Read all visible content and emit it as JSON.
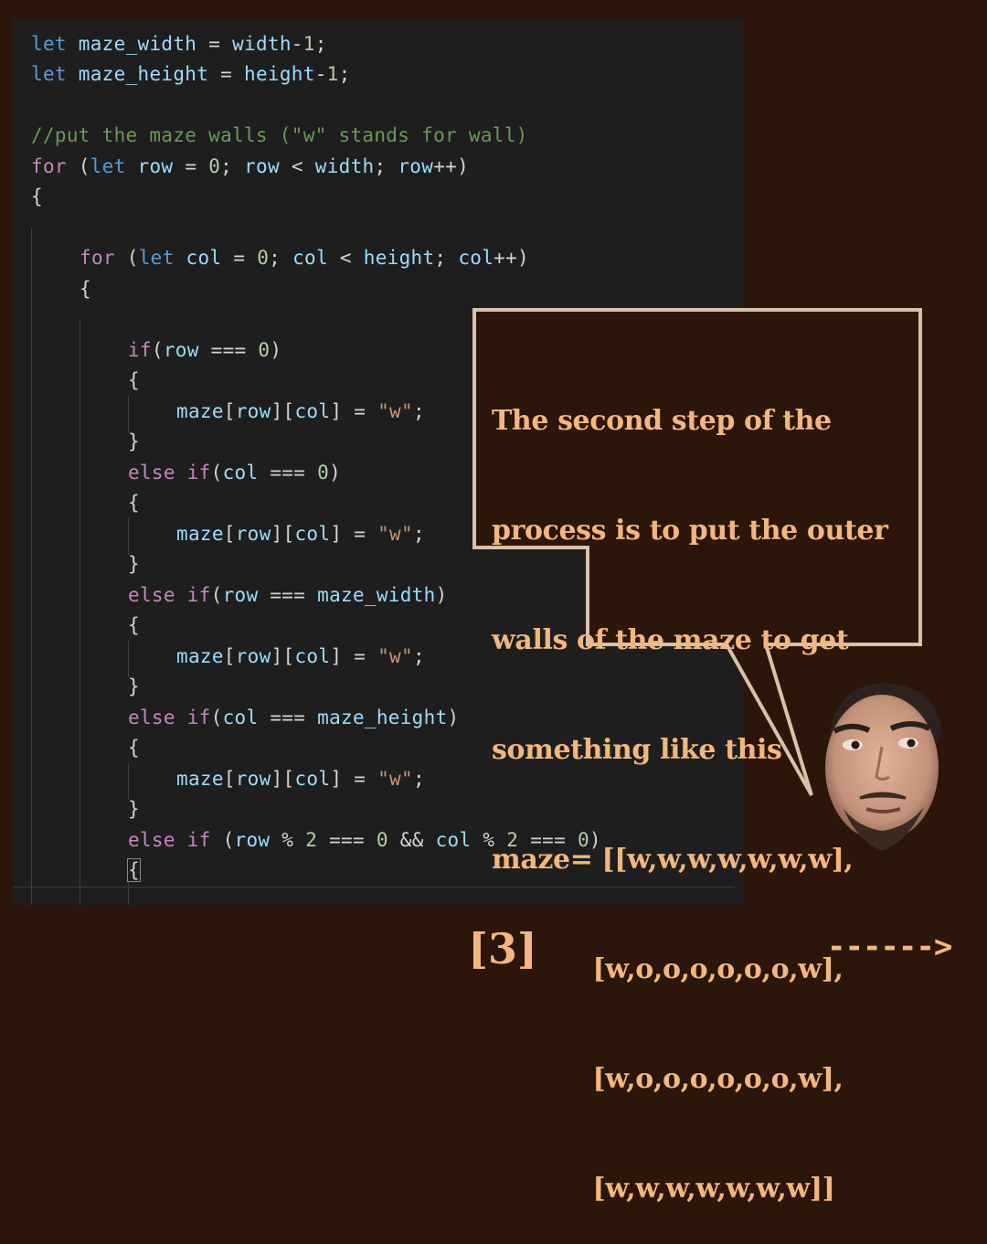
{
  "code": {
    "l1": {
      "kw": "let",
      "var": "maze_width",
      "op": " = ",
      "var2": "width",
      "op2": "-",
      "num": "1",
      "end": ";"
    },
    "l2": {
      "kw": "let",
      "var": "maze_height",
      "op": " = ",
      "var2": "height",
      "op2": "-",
      "num": "1",
      "end": ";"
    },
    "l3": {
      "comment": "//put the maze walls (\"w\" stands for wall)"
    },
    "l4": {
      "kw": "for",
      "p1": " (",
      "kw2": "let",
      "var": "row",
      "op": " = ",
      "num": "0",
      "p2": "; ",
      "var2": "row",
      "op2": " < ",
      "var3": "width",
      "p3": "; ",
      "var4": "row",
      "op3": "++)"
    },
    "l5": {
      "brace": "{"
    },
    "l6": {
      "kw": "for",
      "p1": " (",
      "kw2": "let",
      "var": "col",
      "op": " = ",
      "num": "0",
      "p2": "; ",
      "var2": "col",
      "op2": " < ",
      "var3": "height",
      "p3": "; ",
      "var4": "col",
      "op3": "++)"
    },
    "l7": {
      "brace": "{"
    },
    "l8": {
      "kw": "if",
      "p1": "(",
      "var": "row",
      "op": " === ",
      "num": "0",
      "p2": ")"
    },
    "l9": {
      "brace": "{"
    },
    "l10": {
      "var": "maze",
      "p1": "[",
      "var2": "row",
      "p2": "][",
      "var3": "col",
      "p3": "]",
      "op": " = ",
      "str": "\"w\"",
      "end": ";"
    },
    "l11": {
      "brace": "}"
    },
    "l12": {
      "kw": "else",
      "kw2": "if",
      "p1": "(",
      "var": "col",
      "op": " === ",
      "num": "0",
      "p2": ")"
    },
    "l13": {
      "brace": "{"
    },
    "l14": {
      "var": "maze",
      "p1": "[",
      "var2": "row",
      "p2": "][",
      "var3": "col",
      "p3": "]",
      "op": " = ",
      "str": "\"w\"",
      "end": ";"
    },
    "l15": {
      "brace": "}"
    },
    "l16": {
      "kw": "else",
      "kw2": "if",
      "p1": "(",
      "var": "row",
      "op": " === ",
      "var2": "maze_width",
      "p2": ")"
    },
    "l17": {
      "brace": "{"
    },
    "l18": {
      "var": "maze",
      "p1": "[",
      "var2": "row",
      "p2": "][",
      "var3": "col",
      "p3": "]",
      "op": " = ",
      "str": "\"w\"",
      "end": ";"
    },
    "l19": {
      "brace": "}"
    },
    "l20": {
      "kw": "else",
      "kw2": "if",
      "p1": "(",
      "var": "col",
      "op": " === ",
      "var2": "maze_height",
      "p2": ")"
    },
    "l21": {
      "brace": "{"
    },
    "l22": {
      "var": "maze",
      "p1": "[",
      "var2": "row",
      "p2": "][",
      "var3": "col",
      "p3": "]",
      "op": " = ",
      "str": "\"w\"",
      "end": ";"
    },
    "l23": {
      "brace": "}"
    },
    "l24": {
      "kw": "else",
      "kw2": "if",
      "p1": " (",
      "var": "row",
      "op": " % ",
      "num": "2",
      "op2": " === ",
      "num2": "0",
      "op3": " && ",
      "var2": "col",
      "op4": " % ",
      "num3": "2",
      "op5": " === ",
      "num4": "0",
      "p2": ")"
    },
    "l25": {
      "brace": "{"
    }
  },
  "callout": {
    "lines": [
      "The second step of the",
      "process is to put the outer",
      "walls of the maze to get",
      "something like this",
      "maze= [[w,w,w,w,w,w,w],",
      "           [w,o,o,o,o,o,o,w],",
      "           [w,o,o,o,o,o,o,w],",
      "           [w,w,w,w,w,w,w]]"
    ]
  },
  "footer": {
    "page_number": "[3]",
    "next_arrow": "------>"
  },
  "colors": {
    "background": "#2c150a",
    "editor": "#1e1e1e",
    "accent_text": "#f2b77e",
    "callout_border": "#d9c3a8"
  }
}
